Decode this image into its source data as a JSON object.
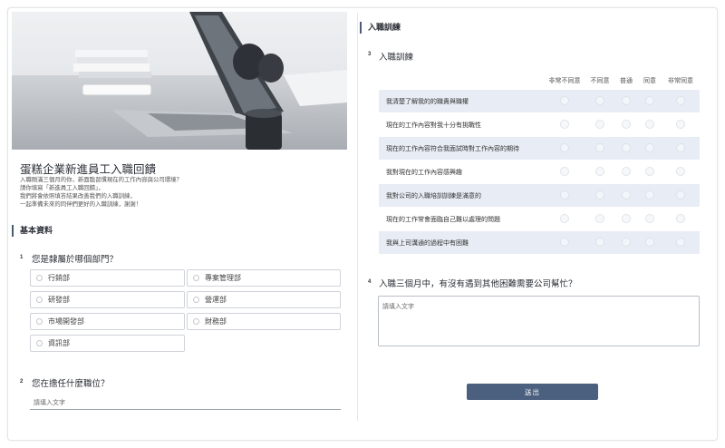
{
  "form": {
    "title": "蛋糕企業新進員工入職回饋",
    "intro": [
      "入職剛滿三個月的你，新面臨習慣現在的工作內容與公司環境？",
      "請你填寫「新進員工入職回饋」，",
      "我們將會依照填答結果改善我們的入職訓練，",
      "一起準備未來的同伴們更好的入職訓練，謝謝！"
    ]
  },
  "section1": {
    "title": "基本資料",
    "q1": {
      "number": "1",
      "text": "您是隸屬於哪個部門？",
      "options": [
        "行銷部",
        "專案管理部",
        "研發部",
        "營運部",
        "市場開發部",
        "財務部",
        "資訊部"
      ]
    },
    "q2": {
      "number": "2",
      "text": "您在擔任什麼職位？",
      "placeholder": "請填入文字"
    }
  },
  "section2": {
    "title": "入職訓練",
    "q3": {
      "number": "3",
      "text": "入職訓練",
      "scale": [
        "非常不同意",
        "不同意",
        "普通",
        "同意",
        "非常同意"
      ],
      "rows": [
        "我清楚了解我的的職責與職權",
        "現在的工作內容對我十分有挑戰性",
        "現在的工作內容符合我面試時對工作內容的期待",
        "我對現在的工作內容感興趣",
        "我對公司的入職培訓訓練是滿意的",
        "現在的工作常會面臨自己難以處理的問題",
        "我與上司溝通的過程中有困難"
      ]
    },
    "q4": {
      "number": "4",
      "text": "入職三個月中，有沒有遇到其他困難需要公司幫忙？",
      "placeholder": "請填入文字"
    },
    "submit_label": "送出"
  },
  "colors": {
    "accent": "#4b5f7e",
    "row_highlight": "#e8edf5"
  }
}
